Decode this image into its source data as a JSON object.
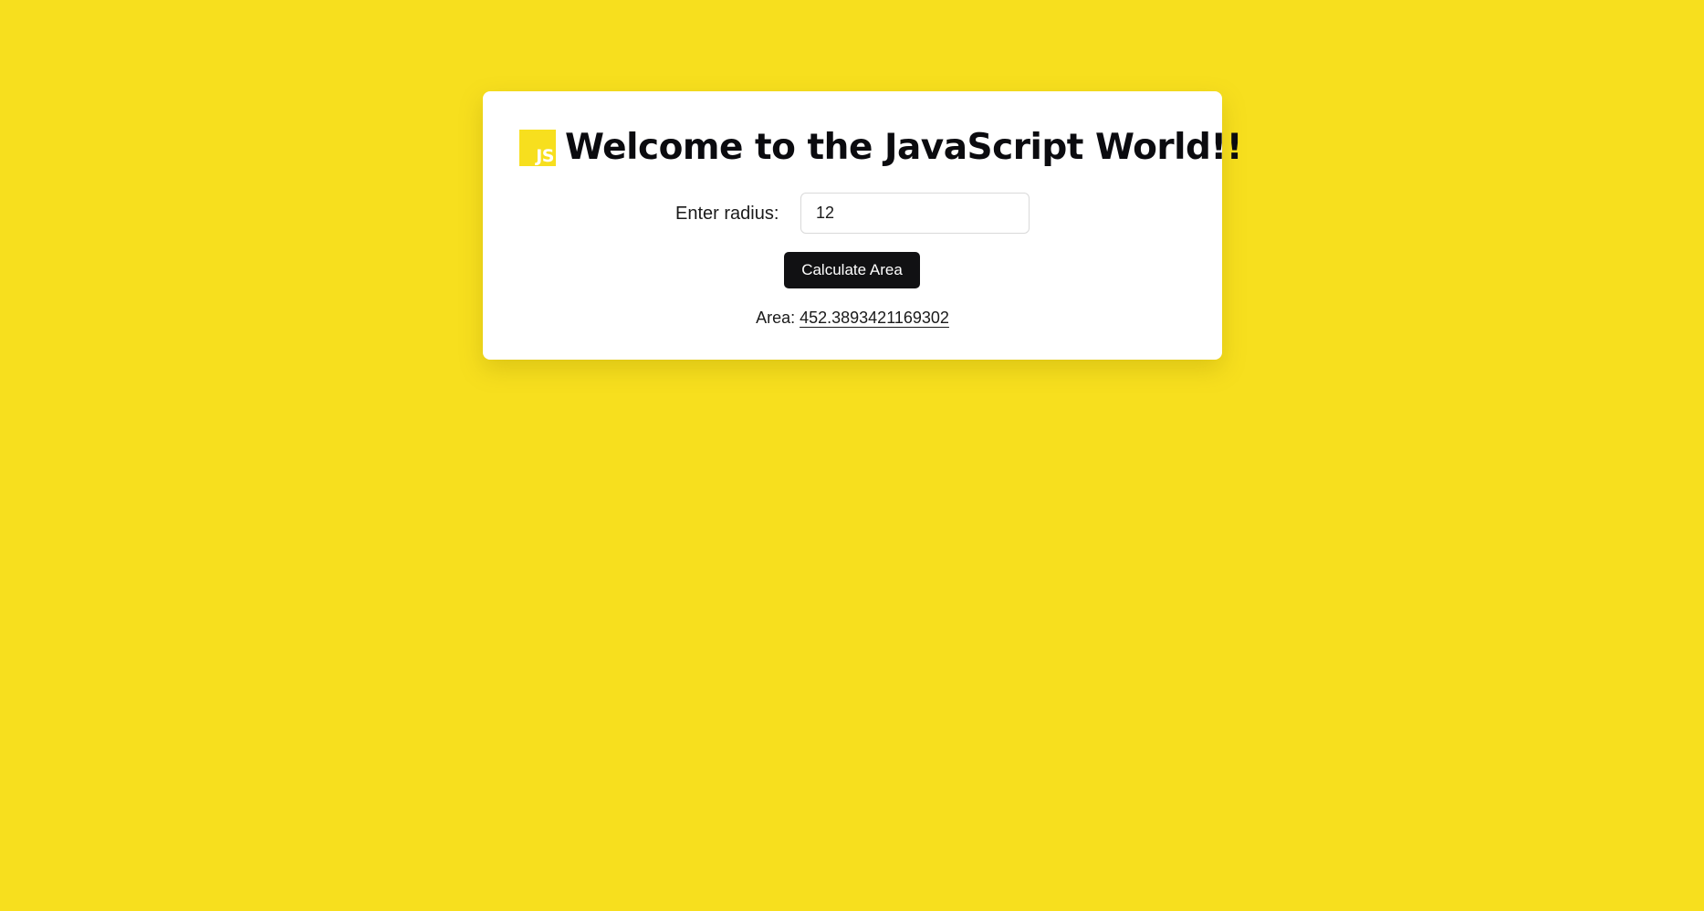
{
  "page": {
    "background_color": "#f7df1e"
  },
  "header": {
    "logo_text": "JS",
    "title": "Welcome to the JavaScript World!!"
  },
  "form": {
    "radius_label": "Enter radius:",
    "radius_value": "12",
    "button_label": "Calculate Area",
    "button_color": "#111113"
  },
  "result": {
    "label": "Area:",
    "value": "452.3893421169302"
  }
}
